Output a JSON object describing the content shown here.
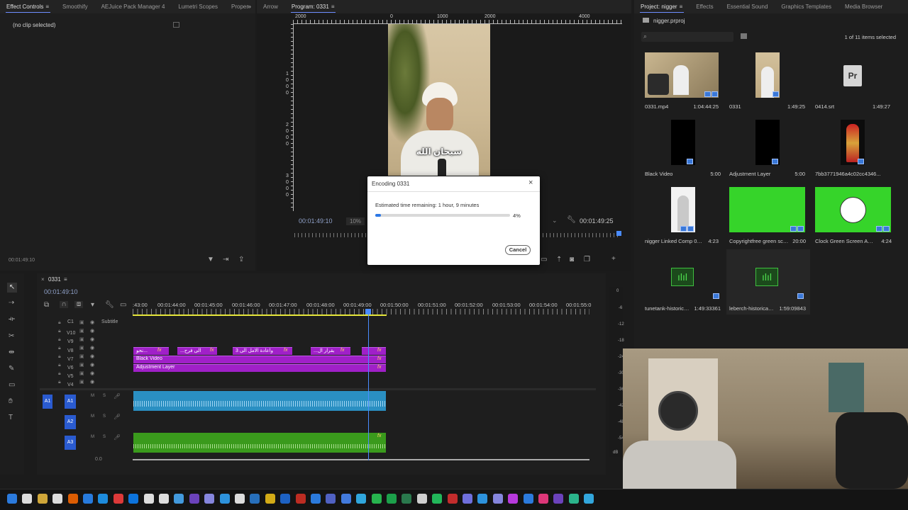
{
  "left_panel": {
    "tabs": [
      "Effect Controls",
      "Smoothify",
      "AEJuice Pack Manager 4",
      "Lumetri Scopes",
      "Proper"
    ],
    "no_clip": "(no clip selected)",
    "timecode": "00:01:49:10"
  },
  "program": {
    "tabs": [
      "Arrow",
      "Program: 0331"
    ],
    "ruler_ticks": [
      "2000",
      "0",
      "1000",
      "2000",
      "4000"
    ],
    "left_ruler": [
      "1000",
      "2000",
      "3000"
    ],
    "caption": "سبحان الله",
    "timecode_left": "00:01:49:10",
    "zoom": "10%",
    "timecode_right": "00:01:49:25"
  },
  "project": {
    "tabs": [
      "Project: nigger",
      "Effects",
      "Essential Sound",
      "Graphics Templates",
      "Media Browser"
    ],
    "file": "nigger.prproj",
    "search_placeholder": "",
    "item_count": "1 of 11 items selected",
    "items": [
      {
        "name": "0331.mp4",
        "duration": "1:04:44:25",
        "icon": "video-thumb"
      },
      {
        "name": "0331",
        "duration": "1:49:25",
        "icon": "sequence-thumb"
      },
      {
        "name": "0414.srt",
        "duration": "1:49:27",
        "icon": "premiere-file-icon",
        "glyph": "Pr"
      },
      {
        "name": "Black Video",
        "duration": "5:00",
        "icon": "black-thumb"
      },
      {
        "name": "Adjustment Layer",
        "duration": "5:00",
        "icon": "black-thumb"
      },
      {
        "name": "7bb3771946a4c02cc4346...",
        "duration": "",
        "icon": "image-thumb"
      },
      {
        "name": "nigger Linked Comp 01/...",
        "duration": "4:23",
        "icon": "comp-thumb"
      },
      {
        "name": "Copyrightfree green scre...",
        "duration": "20:00",
        "icon": "green-thumb"
      },
      {
        "name": "Clock Green Screen Anim...",
        "duration": "4:24",
        "icon": "clock-thumb"
      },
      {
        "name": "tunetank-historical...",
        "duration": "1:49:33361",
        "icon": "audio-thumb"
      },
      {
        "name": "leberch-historical-p...",
        "duration": "1:59:09843",
        "icon": "audio-thumb"
      }
    ]
  },
  "timeline": {
    "sequence_name": "0331",
    "timecode": "00:01:49:10",
    "ruler": [
      ":43:00",
      "00:01:44:00",
      "00:01:45:00",
      "00:01:46:00",
      "00:01:47:00",
      "00:01:48:00",
      "00:01:49:00",
      "00:01:50:00",
      "00:01:51:00",
      "00:01:52:00",
      "00:01:53:00",
      "00:01:54:00",
      "00:01:55:0"
    ],
    "subtitle_track": "Subtitle",
    "c1": "C1",
    "video_tracks": [
      "V10",
      "V9",
      "V8",
      "V7",
      "V6",
      "V5",
      "V4"
    ],
    "audio_tracks": [
      "A1",
      "A2",
      "A3"
    ],
    "audio_target": "A1",
    "clips_v8": [
      "نحو...",
      "...الى فرح",
      "واعادة الامل الى 3",
      "...بقرار ال"
    ],
    "clip_v7": "Black Video",
    "clip_v6": "Adjustment Layer",
    "fx": "fx",
    "bottom_value": "0.0",
    "track_buttons": {
      "mute": "M",
      "solo": "S"
    }
  },
  "meter": {
    "scale": [
      "0",
      "-6",
      "-12",
      "-18",
      "-24",
      "-30",
      "-36",
      "-42",
      "-48",
      "-54",
      "dB"
    ]
  },
  "dialog": {
    "title": "Encoding 0331",
    "estimate": "Estimated time remaining: 1 hour, 9 minutes",
    "progress": 0.04,
    "percent": "4%",
    "cancel": "Cancel"
  },
  "colors": {
    "accent": "#4a8cff",
    "video_clip": "#a020c8",
    "audio_clip": "#2a8fc2",
    "audio_clip_green": "#3a9a1c",
    "green_screen": "#36d42a"
  }
}
